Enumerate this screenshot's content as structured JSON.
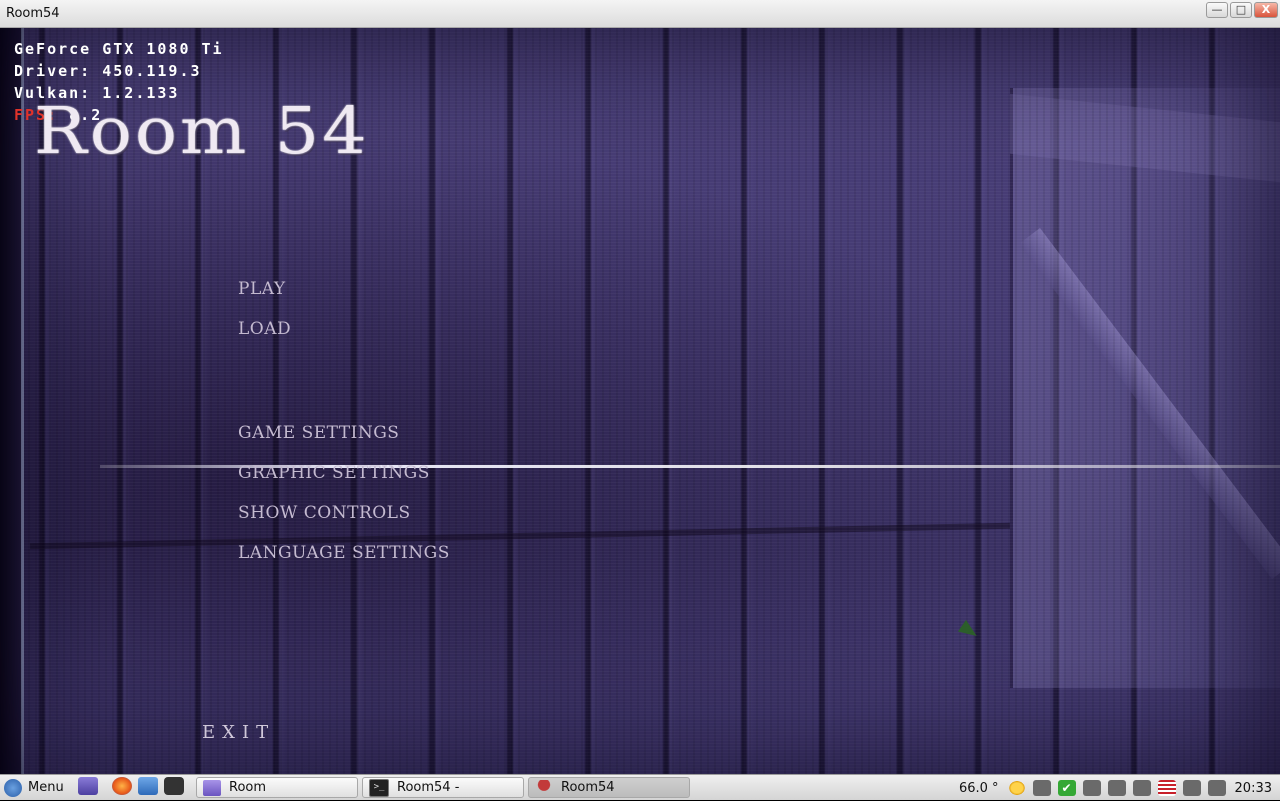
{
  "window": {
    "title": "Room54",
    "minimize": "—",
    "maximize": "□",
    "close": "X"
  },
  "overlay": {
    "gpu": "GeForce GTX 1080 Ti",
    "driver": "Driver: 450.119.3",
    "vulkan": "Vulkan: 1.2.133",
    "fps_label": "FPS:",
    "fps_value": " 8.2"
  },
  "game": {
    "logo": "Room 54",
    "menu": {
      "play": "PLAY",
      "load": "LOAD",
      "game_settings": "GAME SETTINGS",
      "graphic_settings": "GRAPHIC SETTINGS",
      "show_controls": "SHOW CONTROLS",
      "language_settings": "LANGUAGE SETTINGS",
      "exit": "EXIT"
    }
  },
  "taskbar": {
    "menu_label": "Menu",
    "tasks": [
      {
        "label": "Room",
        "icon": "folder-icon",
        "active": false
      },
      {
        "label": "Room54 -",
        "icon": "terminal-icon",
        "active": false
      },
      {
        "label": "Room54",
        "icon": "wine-icon",
        "active": true
      }
    ],
    "terminal_glyph": ">_",
    "check_glyph": "✔",
    "temperature": "66.0 °",
    "clock": "20:33"
  }
}
